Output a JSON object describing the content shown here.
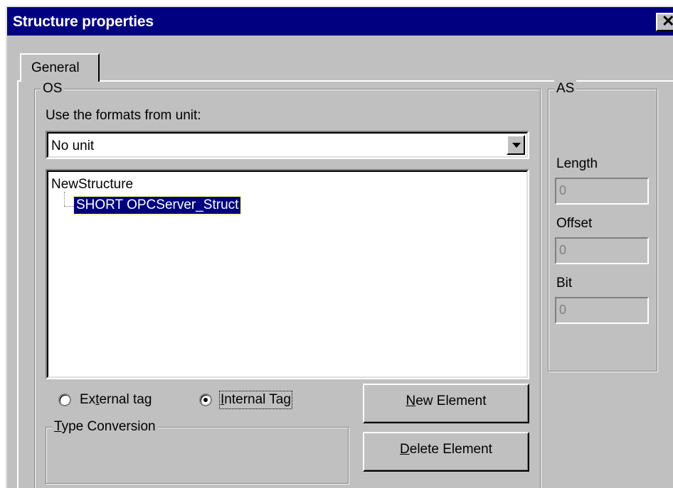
{
  "window": {
    "title": "Structure properties",
    "close_glyph": "✕"
  },
  "tabs": [
    {
      "label": "General",
      "selected": true
    }
  ],
  "os_group": {
    "title": "OS",
    "formats_label": "Use the formats from unit:",
    "unit_combo": {
      "value": "No unit",
      "icon": "chevron-down-icon"
    },
    "tree": {
      "root": "NewStructure",
      "children": [
        {
          "label": "SHORT OPCServer_Struct",
          "selected": true
        }
      ]
    },
    "tag_type": {
      "options": [
        {
          "label_pre": "Ex",
          "accel": "t",
          "label_post": "ernal tag",
          "checked": false
        },
        {
          "label_pre": "",
          "accel": "I",
          "label_post": "nternal Tag",
          "checked": true
        }
      ]
    },
    "type_conversion": {
      "title_accel": "T",
      "title_rest": "ype Conversion"
    },
    "buttons": {
      "new_element": {
        "accel": "N",
        "rest": "ew Element"
      },
      "delete_element": {
        "accel": "D",
        "rest": "elete Element"
      }
    }
  },
  "as_group": {
    "title": "AS",
    "length": {
      "label": "Length",
      "value": "0"
    },
    "offset": {
      "label": "Offset",
      "value": "0"
    },
    "bit": {
      "label": "Bit",
      "value": "0"
    }
  }
}
